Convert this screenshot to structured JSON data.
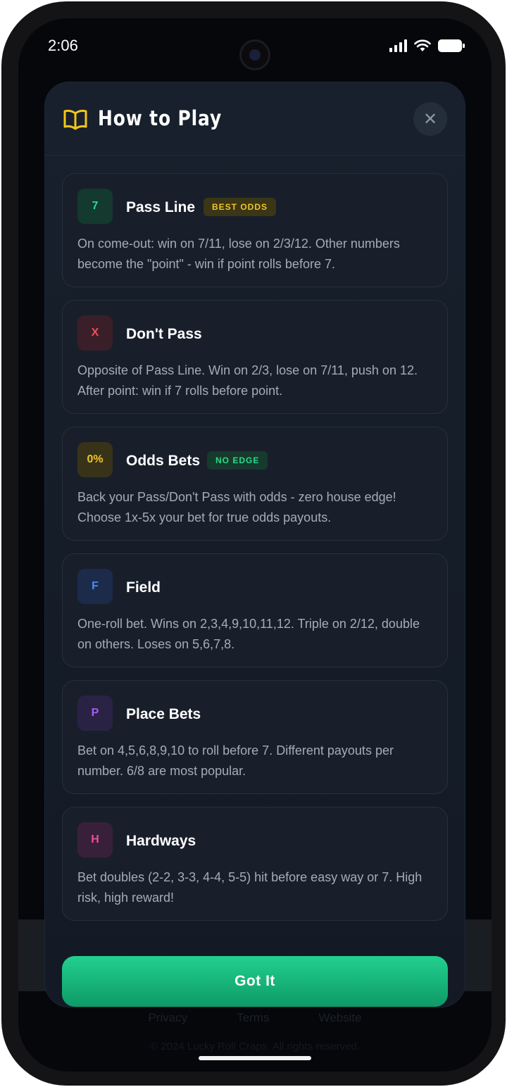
{
  "status_bar": {
    "time": "2:06"
  },
  "background": {
    "footer_links": [
      "Privacy",
      "Terms",
      "Website"
    ],
    "copyright": "© 2024 Lucky Roll Craps. All rights reserved."
  },
  "modal": {
    "title": "How to Play",
    "close_glyph": "✕",
    "cards": [
      {
        "icon_text": "7",
        "title": "Pass Line",
        "badge": "BEST ODDS",
        "description": "On come-out: win on 7/11, lose on 2/3/12. Other numbers become the \"point\" - win if point rolls before 7."
      },
      {
        "icon_text": "X",
        "title": "Don't Pass",
        "badge": "",
        "description": "Opposite of Pass Line. Win on 2/3, lose on 7/11, push on 12. After point: win if 7 rolls before point."
      },
      {
        "icon_text": "0%",
        "title": "Odds Bets",
        "badge": "NO EDGE",
        "description": "Back your Pass/Don't Pass with odds - zero house edge! Choose 1x-5x your bet for true odds payouts."
      },
      {
        "icon_text": "F",
        "title": "Field",
        "badge": "",
        "description": "One-roll bet. Wins on 2,3,4,9,10,11,12. Triple on 2/12, double on others. Loses on 5,6,7,8."
      },
      {
        "icon_text": "P",
        "title": "Place Bets",
        "badge": "",
        "description": "Bet on 4,5,6,8,9,10 to roll before 7. Different payouts per number. 6/8 are most popular."
      },
      {
        "icon_text": "H",
        "title": "Hardways",
        "badge": "",
        "description": "Bet doubles (2-2, 3-3, 4-4, 5-5) hit before easy way or 7. High risk, high reward!"
      }
    ],
    "primary_button": "Got It"
  },
  "colors": {
    "accent_green": "#1fc98a",
    "gold": "#e8c21a",
    "red": "#e5484d",
    "blue": "#3b82f6",
    "purple": "#a855f7",
    "pink": "#ec4899"
  }
}
